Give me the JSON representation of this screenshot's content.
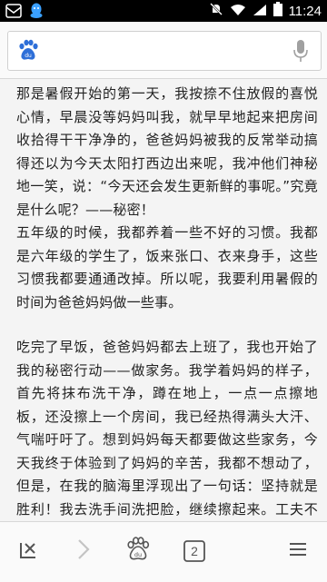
{
  "status_bar": {
    "time": "11:24",
    "icons": [
      "notification-icon",
      "qq-icon",
      "silent-icon",
      "wifi-icon",
      "signal-icon",
      "battery-icon"
    ]
  },
  "search_bar": {
    "placeholder": "",
    "logo": "baidu-paw-icon",
    "voice": "microphone-icon"
  },
  "article": {
    "paragraphs": [
      "那是暑假开始的第一天，我按捺不住放假的喜悦心情，早晨没等妈妈叫我，就早早地起来把房间收拾得干干净净的，爸爸妈妈被我的反常举动搞得还以为今天太阳打西边出来呢，我冲他们神秘地一笑，说：“今天还会发生更新鲜的事呢。”究竟是什么呢？——秘密！",
      "五年级的时候，我都养着一些不好的习惯。我都是六年级的学生了，饭来张口、衣来身手，这些习惯我都要通通改掉。所以呢，我要利用暑假的时间为爸爸妈妈做一些事。",
      "吃完了早饭，爸爸妈妈都去上班了，我也开始了我的秘密行动——做家务。我学着妈妈的样子，首先将抹布洗干净，蹲在地上，一点一点擦地板，还没擦上一个房间，我已经热得满头大汗、气喘吁吁了。想到妈妈每天都要做这些家务，今天我终于体验到了妈妈的辛苦，我都不想动了，但是，在我的脑海里浮现出了一句话：坚持就是胜利！我去洗手间洗把脸，继续擦起来。工夫不负有心人，大约过了一个小时，我终于把地板擦干净了。地板变干净了，我"
    ]
  },
  "bottom_bar": {
    "items": [
      {
        "name": "close-page-icon",
        "enabled": true
      },
      {
        "name": "forward-arrow-icon",
        "enabled": false
      },
      {
        "name": "baidu-home-icon",
        "enabled": true
      },
      {
        "name": "tabs-icon",
        "count": "2",
        "enabled": true
      },
      {
        "name": "menu-icon",
        "enabled": true
      }
    ]
  }
}
